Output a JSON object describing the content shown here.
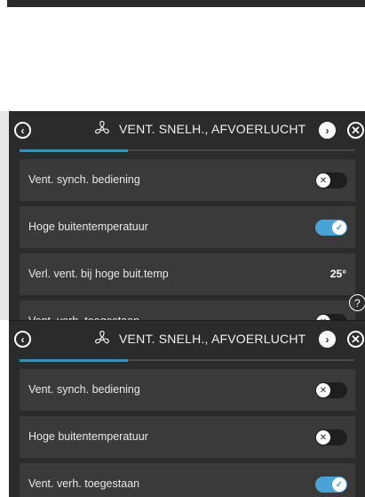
{
  "title": "VENT. SNELH., AFVOERLUCHT",
  "nav": {
    "back_icon": "chevron-left-icon",
    "forward_icon": "chevron-right-icon",
    "close_icon": "close-icon",
    "help_icon": "help-icon"
  },
  "screen1": {
    "rows": [
      {
        "label": "Vent. synch. bediening",
        "toggle": "off"
      },
      {
        "label": "Hoge buitentemperatuur",
        "toggle": "on"
      },
      {
        "label": "Verl. vent. bij hoge buit.temp",
        "value": "25°"
      },
      {
        "label": "Vent. verh. toegestaan",
        "toggle": "off"
      }
    ]
  },
  "screen2": {
    "rows": [
      {
        "label": "Vent. synch. bediening",
        "toggle": "off"
      },
      {
        "label": "Hoge buitentemperatuur",
        "toggle": "off"
      },
      {
        "label": "Vent. verh. toegestaan",
        "toggle": "on"
      }
    ]
  },
  "colors": {
    "background": "#2b2b2b",
    "row": "#3a3a3a",
    "accent": "#4aa3d6",
    "tab_indicator": "#3d8fb5"
  }
}
